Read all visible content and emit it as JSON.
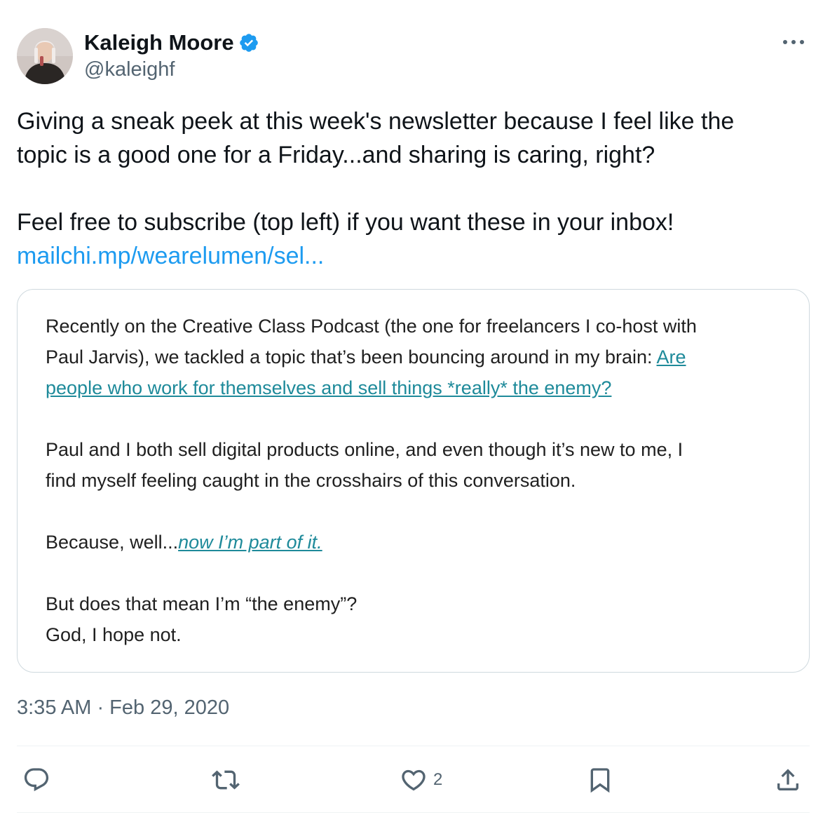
{
  "author": {
    "display_name": "Kaleigh Moore",
    "handle": "@kaleighf",
    "verified": true,
    "avatar_icon": "profile-photo"
  },
  "tweet": {
    "line1": "Giving a sneak peek at this week's newsletter because I feel like the",
    "line2": "topic is a good one for a Friday...and sharing is caring, right?",
    "line3": "Feel free to subscribe (top left) if you want these in your inbox!",
    "link_text": "mailchi.mp/wearelumen/sel...",
    "timestamp": "3:35 AM · Feb 29, 2020"
  },
  "newsletter": {
    "p1_line1": "Recently on the Creative Class Podcast (the one for freelancers I co-host with",
    "p1_line2_text": "Paul Jarvis), we tackled a topic that’s been bouncing around in my brain: ",
    "p1_line2_link": "Are",
    "p1_line3_link": "people who work for themselves and sell things *really* the enemy?",
    "p2_line1": "Paul and I both sell digital products online, and even though it’s new to me, I",
    "p2_line2": "find myself feeling caught in the crosshairs of this conversation.",
    "p3_text": "Because, well...",
    "p3_link": "now I’m part of it.",
    "p4_line1": "But does that mean I’m “the enemy”?",
    "p4_line2": "God, I hope not."
  },
  "actions": {
    "reply_icon": "reply-icon",
    "retweet_icon": "retweet-icon",
    "like_icon": "heart-icon",
    "like_count": "2",
    "bookmark_icon": "bookmark-icon",
    "share_icon": "share-icon"
  },
  "colors": {
    "link_blue": "#1d9bf0",
    "secondary_text": "#536471",
    "primary_text": "#0f1419",
    "verified_blue": "#1d9bf0",
    "newsletter_link": "#1e8a9a"
  }
}
